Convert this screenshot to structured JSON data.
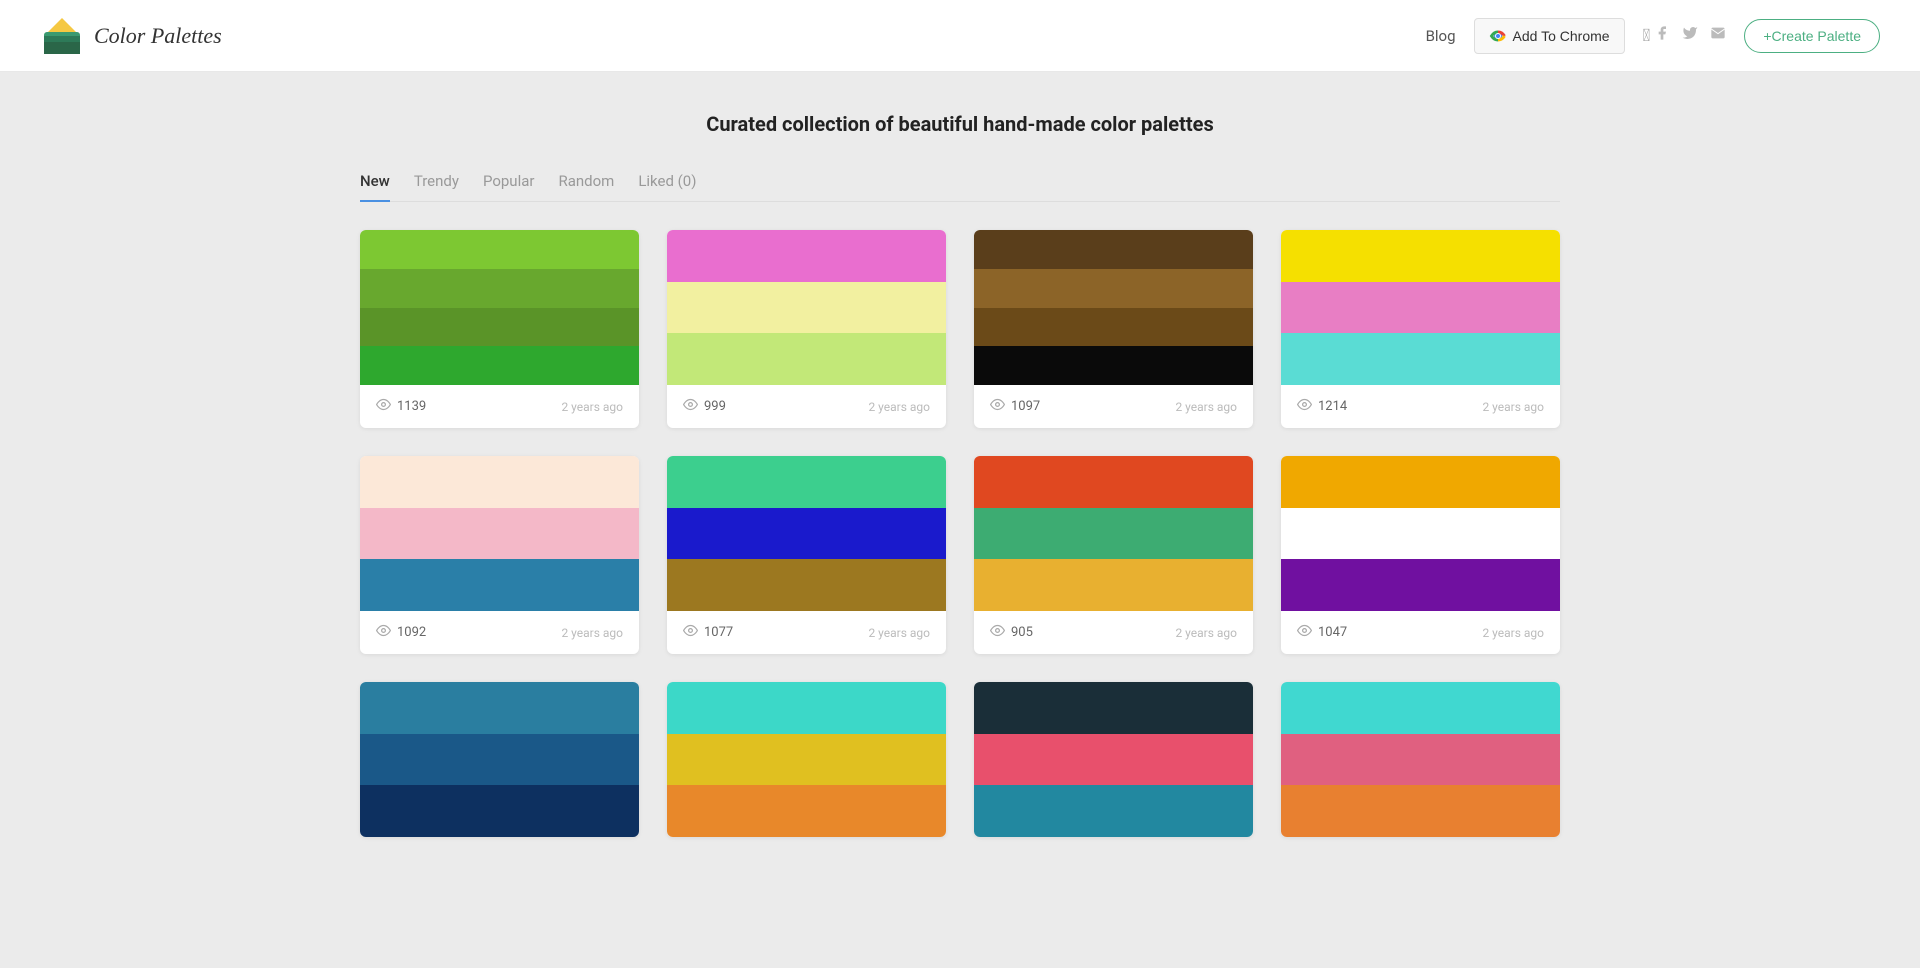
{
  "header": {
    "logo_text": "Color Palettes",
    "blog_label": "Blog",
    "add_to_chrome_label": "Add To Chrome",
    "create_palette_label": "+Create Palette",
    "social": [
      "facebook",
      "twitter",
      "email"
    ]
  },
  "page": {
    "title": "Curated collection of beautiful hand-made color palettes"
  },
  "tabs": [
    {
      "label": "New",
      "active": true
    },
    {
      "label": "Trendy",
      "active": false
    },
    {
      "label": "Popular",
      "active": false
    },
    {
      "label": "Random",
      "active": false
    },
    {
      "label": "Liked (0)",
      "active": false
    }
  ],
  "palettes": [
    {
      "id": 1,
      "views": "1139",
      "date": "2 years ago",
      "swatches": [
        "#7dc832",
        "#6aaa30",
        "#5a9428",
        "#2ea82e"
      ]
    },
    {
      "id": 2,
      "views": "999",
      "date": "2 years ago",
      "swatches": [
        "#e96ecf",
        "#f0f0a0",
        "#c4e87a"
      ]
    },
    {
      "id": 3,
      "views": "1097",
      "date": "2 years ago",
      "swatches": [
        "#5a3e1b",
        "#8c6428",
        "#6b4a18",
        "#0d0d0d"
      ]
    },
    {
      "id": 4,
      "views": "1214",
      "date": "2 years ago",
      "swatches": [
        "#f5e000",
        "#e87ec4",
        "#5adcd4"
      ]
    },
    {
      "id": 5,
      "views": "1092",
      "date": "2 years ago",
      "swatches": [
        "#fce8d8",
        "#f4b8c8",
        "#2a7fa8"
      ]
    },
    {
      "id": 6,
      "views": "1077",
      "date": "2 years ago",
      "swatches": [
        "#3ccf8e",
        "#1a1acc",
        "#9c7820"
      ]
    },
    {
      "id": 7,
      "views": "905",
      "date": "2 years ago",
      "swatches": [
        "#e04820",
        "#3dac72",
        "#e8b030"
      ]
    },
    {
      "id": 8,
      "views": "1047",
      "date": "2 years ago",
      "swatches": [
        "#f0a800",
        "#ffffff",
        "#7010a0"
      ]
    },
    {
      "id": 9,
      "views": "",
      "date": "",
      "swatches": [
        "#2a7ea0",
        "#1a5888",
        "#0d3060"
      ]
    },
    {
      "id": 10,
      "views": "",
      "date": "",
      "swatches": [
        "#3cd8c8",
        "#e0c020"
      ]
    },
    {
      "id": 11,
      "views": "",
      "date": "",
      "swatches": [
        "#1a2e38",
        "#e8506c"
      ]
    },
    {
      "id": 12,
      "views": "",
      "date": "",
      "swatches": [
        "#40d8d0",
        "#e06080"
      ]
    }
  ]
}
